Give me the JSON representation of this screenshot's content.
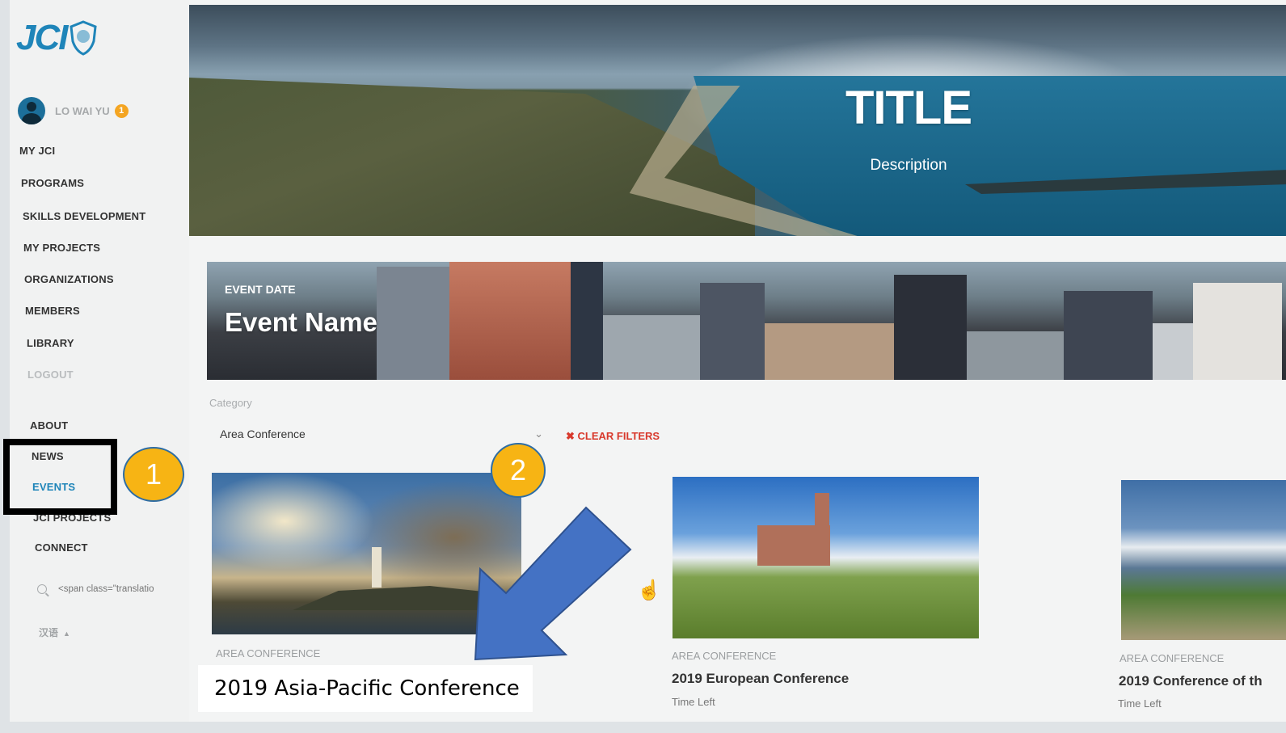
{
  "sidebar": {
    "logo_text": "JCI",
    "user": {
      "name": "LO WAI YU",
      "badge": "1"
    },
    "nav": [
      {
        "label": "MY JCI"
      },
      {
        "label": "PROGRAMS"
      },
      {
        "label": "SKILLS DEVELOPMENT"
      },
      {
        "label": "MY PROJECTS"
      },
      {
        "label": "ORGANIZATIONS"
      },
      {
        "label": "MEMBERS"
      },
      {
        "label": "LIBRARY"
      },
      {
        "label": "LOGOUT"
      }
    ],
    "nav2": [
      {
        "label": "ABOUT"
      },
      {
        "label": "NEWS"
      },
      {
        "label": "EVENTS",
        "active": true
      },
      {
        "label": "JCI PROJECTS"
      },
      {
        "label": "CONNECT"
      }
    ],
    "search_placeholder": "<span class=\"translatio",
    "language": "汉语"
  },
  "hero": {
    "title": "TITLE",
    "description": "Description"
  },
  "event_banner": {
    "date": "EVENT DATE",
    "name": "Event Name"
  },
  "filters": {
    "category_label": "Category",
    "category_value": "Area Conference",
    "clear_label": "CLEAR FILTERS"
  },
  "cards": [
    {
      "category": "AREA CONFERENCE",
      "title": "",
      "time_left": ""
    },
    {
      "category": "AREA CONFERENCE",
      "title": "2019 European Conference",
      "time_left": "Time Left"
    },
    {
      "category": "AREA CONFERENCE",
      "title": "2019 Conference of th",
      "time_left": "Time Left"
    }
  ],
  "annotations": {
    "circle_1": "1",
    "circle_2": "2",
    "callout": "2019 Asia-Pacific Conference"
  },
  "colors": {
    "brand_blue": "#1f85b9",
    "badge_orange": "#f4a522",
    "clear_red": "#d8392c",
    "annotation_yellow": "#f7b414",
    "arrow_blue": "#4472c4"
  }
}
